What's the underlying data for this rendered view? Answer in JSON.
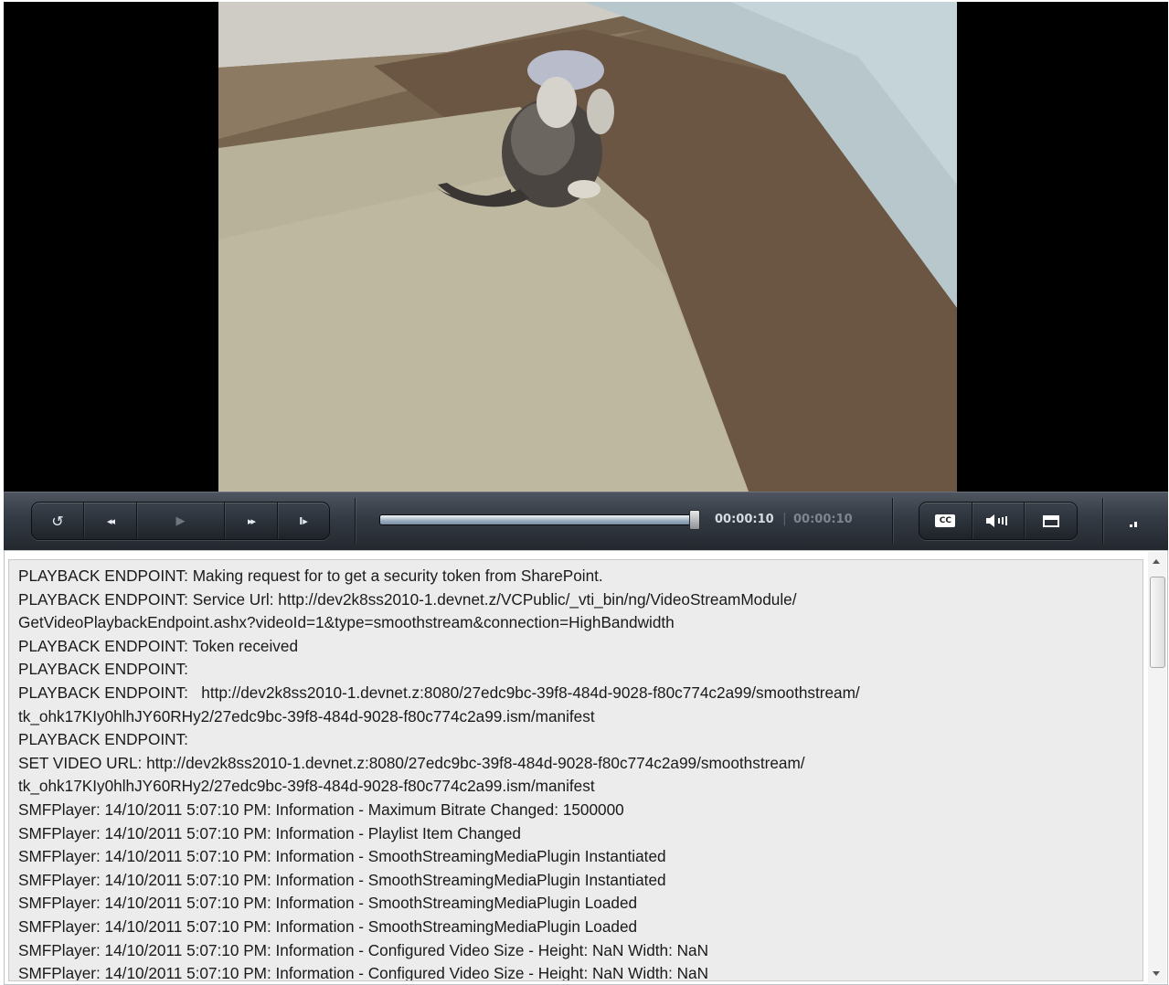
{
  "player": {
    "time_current": "00:00:10",
    "time_separator": "|",
    "time_total": "00:00:10",
    "progress_fraction": 1.0,
    "cc_label": "CC",
    "icons": {
      "replay": "replay-icon",
      "rewind": "rewind-icon",
      "play": "play-icon",
      "fast_forward": "fast-forward-icon",
      "step_forward": "step-forward-icon",
      "closed_captions": "closed-captions-icon",
      "volume": "volume-icon",
      "fullscreen": "fullscreen-icon",
      "signal": "signal-strength-icon"
    },
    "glyphs": {
      "replay": "↺",
      "rewind": "◂◂",
      "play": "▶",
      "fast_forward": "▸▸",
      "step_forward": "I▸"
    }
  },
  "log": {
    "lines": [
      "PLAYBACK ENDPOINT: Making request for to get a security token from SharePoint.",
      "PLAYBACK ENDPOINT: Service Url: http://dev2k8ss2010-1.devnet.z/VCPublic/_vti_bin/ng/VideoStreamModule/",
      "GetVideoPlaybackEndpoint.ashx?videoId=1&type=smoothstream&connection=HighBandwidth",
      "PLAYBACK ENDPOINT: Token received",
      "PLAYBACK ENDPOINT:",
      "PLAYBACK ENDPOINT:   http://dev2k8ss2010-1.devnet.z:8080/27edc9bc-39f8-484d-9028-f80c774c2a99/smoothstream/",
      "tk_ohk17KIy0hlhJY60RHy2/27edc9bc-39f8-484d-9028-f80c774c2a99.ism/manifest",
      "PLAYBACK ENDPOINT:",
      "SET VIDEO URL: http://dev2k8ss2010-1.devnet.z:8080/27edc9bc-39f8-484d-9028-f80c774c2a99/smoothstream/",
      "tk_ohk17KIy0hlhJY60RHy2/27edc9bc-39f8-484d-9028-f80c774c2a99.ism/manifest",
      "SMFPlayer: 14/10/2011 5:07:10 PM: Information - Maximum Bitrate Changed: 1500000",
      "SMFPlayer: 14/10/2011 5:07:10 PM: Information - Playlist Item Changed",
      "SMFPlayer: 14/10/2011 5:07:10 PM: Information - SmoothStreamingMediaPlugin Instantiated",
      "SMFPlayer: 14/10/2011 5:07:10 PM: Information - SmoothStreamingMediaPlugin Instantiated",
      "SMFPlayer: 14/10/2011 5:07:10 PM: Information - SmoothStreamingMediaPlugin Loaded",
      "SMFPlayer: 14/10/2011 5:07:10 PM: Information - SmoothStreamingMediaPlugin Loaded",
      "SMFPlayer: 14/10/2011 5:07:10 PM: Information - Configured Video Size - Height: NaN Width: NaN",
      "SMFPlayer: 14/10/2011 5:07:10 PM: Information - Configured Video Size - Height: NaN Width: NaN"
    ]
  }
}
